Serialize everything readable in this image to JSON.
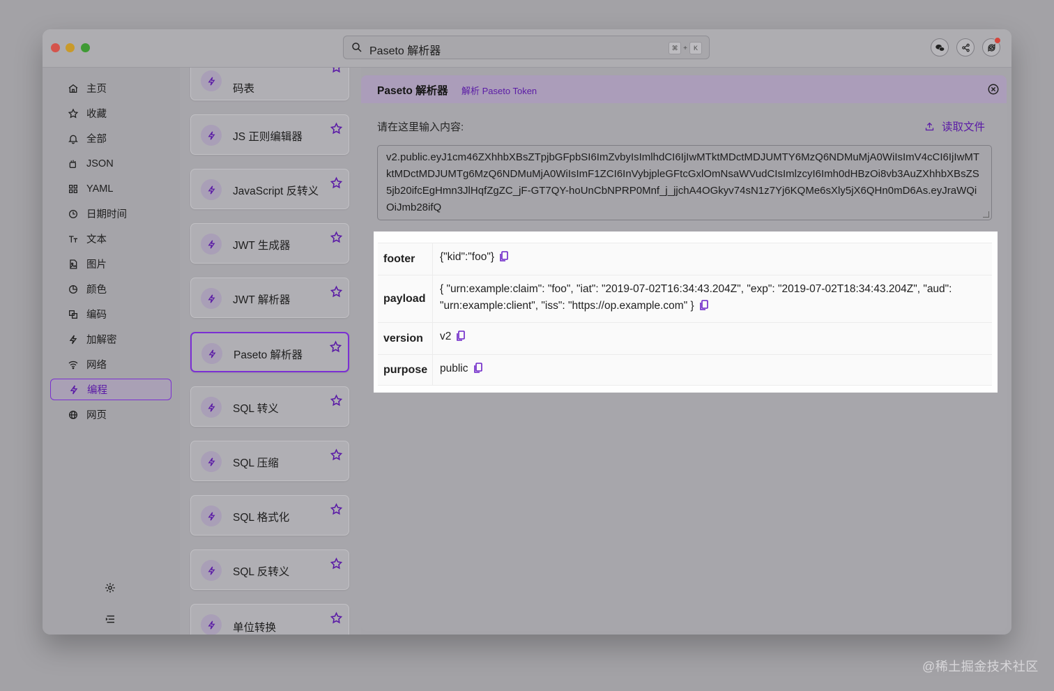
{
  "search": {
    "text": "Paseto 解析器",
    "shortcut_cmd": "⌘",
    "shortcut_plus": "+",
    "shortcut_key": "K"
  },
  "top_icons": [
    "wechat-icon",
    "share-icon",
    "update-icon"
  ],
  "sidebar": {
    "items": [
      {
        "label": "主页",
        "icon": "home-icon"
      },
      {
        "label": "收藏",
        "icon": "star-icon"
      },
      {
        "label": "全部",
        "icon": "bell-icon"
      },
      {
        "label": "JSON",
        "icon": "json-icon"
      },
      {
        "label": "YAML",
        "icon": "grid-icon"
      },
      {
        "label": "日期时间",
        "icon": "clock-icon"
      },
      {
        "label": "文本",
        "icon": "text-icon"
      },
      {
        "label": "图片",
        "icon": "image-icon"
      },
      {
        "label": "颜色",
        "icon": "palette-icon"
      },
      {
        "label": "编码",
        "icon": "encode-icon"
      },
      {
        "label": "加解密",
        "icon": "bolt-icon"
      },
      {
        "label": "网络",
        "icon": "wifi-icon"
      },
      {
        "label": "编程",
        "icon": "bolt-icon",
        "active": true
      },
      {
        "label": "网页",
        "icon": "globe-icon"
      }
    ],
    "bottom_icons": [
      "settings-icon",
      "menu-icon"
    ]
  },
  "tools": {
    "items": [
      {
        "label": "JavaScript 反键事件码表"
      },
      {
        "label": "JS 正则编辑器"
      },
      {
        "label": "JavaScript 反转义"
      },
      {
        "label": "JWT 生成器"
      },
      {
        "label": "JWT 解析器"
      },
      {
        "label": "Paseto 解析器",
        "active": true
      },
      {
        "label": "SQL 转义"
      },
      {
        "label": "SQL 压缩"
      },
      {
        "label": "SQL 格式化"
      },
      {
        "label": "SQL 反转义"
      },
      {
        "label": "单位转换"
      }
    ],
    "first_partial_line2": "码表"
  },
  "panel": {
    "title": "Paseto 解析器",
    "subtitle": "解析 Paseto Token",
    "input_label": "请在这里输入内容:",
    "read_file": "读取文件",
    "token": "v2.public.eyJ1cm46ZXhhbXBsZTpjbGFpbSI6ImZvbyIsImlhdCI6IjIwMTktMDctMDJUMTY6MzQ6NDMuMjA0WiIsImV4cCI6IjIwMTktMDctMDJUMTg6MzQ6NDMuMjA0WiIsImF1ZCI6InVybjpleGFtcGxlOmNsaWVudCIsImlzcyI6Imh0dHBzOi8vb3AuZXhhbXBsZS5jb20ifcEgHmn3JlHqfZgZC_jF-GT7QY-hoUnCbNPRP0Mnf_j_jjchA4OGkyv74sN1z7Yj6KQMe6sXly5jX6QHn0mD6As.eyJraWQiOiJmb28ifQ"
  },
  "result": {
    "rows": [
      {
        "key": "footer",
        "value": "{\"kid\":\"foo\"}"
      },
      {
        "key": "payload",
        "value": "{ \"urn:example:claim\": \"foo\", \"iat\": \"2019-07-02T16:34:43.204Z\", \"exp\": \"2019-07-02T18:34:43.204Z\", \"aud\": \"urn:example:client\", \"iss\": \"https://op.example.com\" }"
      },
      {
        "key": "version",
        "value": "v2"
      },
      {
        "key": "purpose",
        "value": "public"
      }
    ]
  },
  "watermark": "@稀土掘金技术社区",
  "colors": {
    "accent": "#7b2fd3",
    "accent_text": "#5a1aa6",
    "backdrop": "#a6a5aa"
  }
}
